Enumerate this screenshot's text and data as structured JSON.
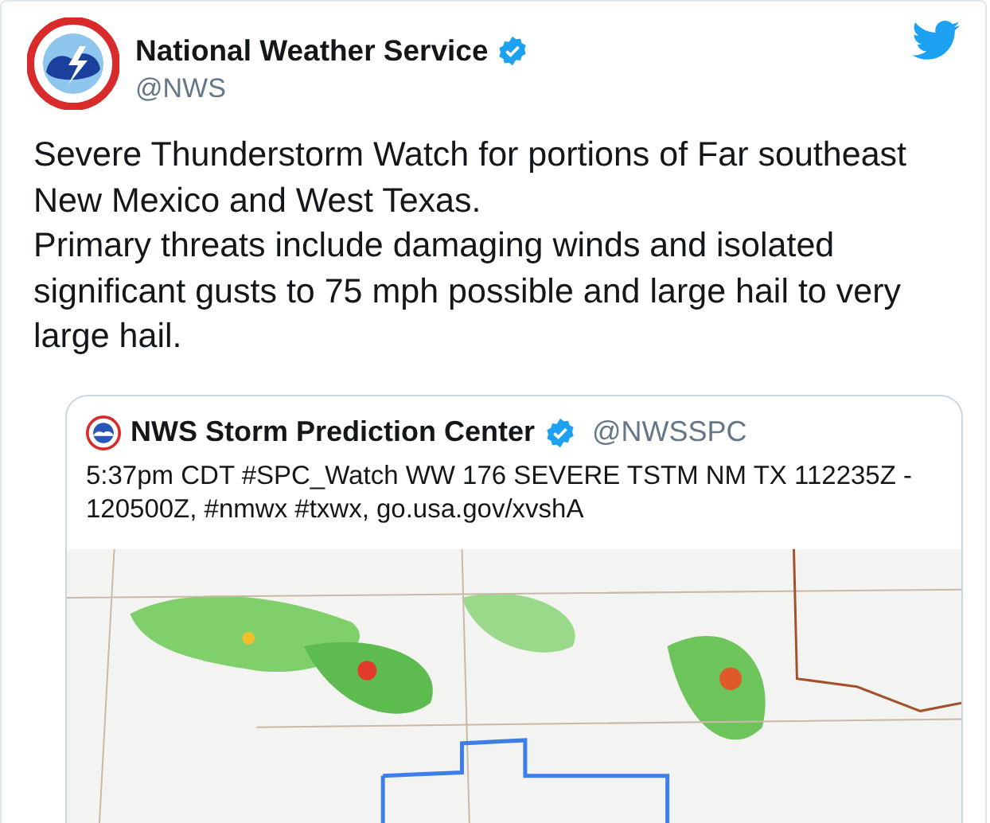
{
  "tweet": {
    "author": {
      "name": "National Weather Service",
      "handle": "@NWS",
      "verified": true
    },
    "text": [
      "Severe Thunderstorm Watch for portions of Far southeast New Mexico and West Texas.",
      "Primary threats include damaging winds and isolated significant gusts to 75 mph possible and large hail to very large hail."
    ],
    "quoted_tweet": {
      "author": {
        "name": "NWS Storm Prediction Center",
        "handle": "@NWSSPC",
        "verified": true
      },
      "text": "5:37pm CDT #SPC_Watch WW 176 SEVERE TSTM NM TX 112235Z - 120500Z, #nmwx #txwx, go.usa.gov/xvshA"
    }
  }
}
